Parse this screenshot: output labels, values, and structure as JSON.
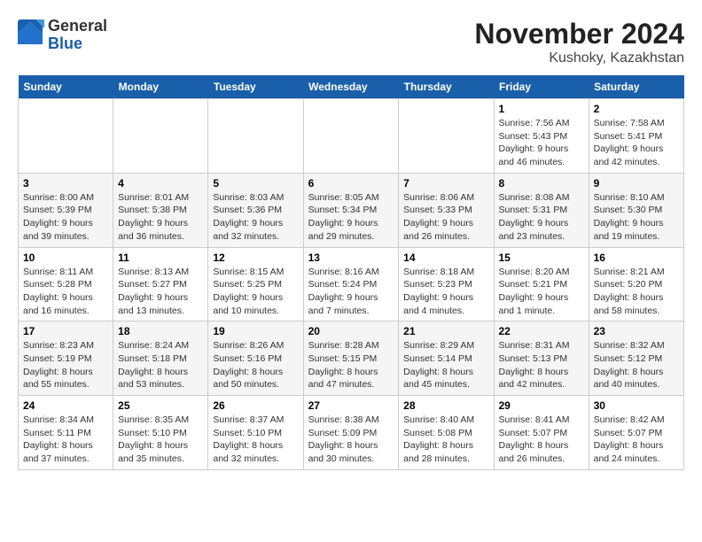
{
  "logo": {
    "general": "General",
    "blue": "Blue"
  },
  "title": "November 2024",
  "subtitle": "Kushoky, Kazakhstan",
  "days_of_week": [
    "Sunday",
    "Monday",
    "Tuesday",
    "Wednesday",
    "Thursday",
    "Friday",
    "Saturday"
  ],
  "weeks": [
    [
      {
        "day": "",
        "info": ""
      },
      {
        "day": "",
        "info": ""
      },
      {
        "day": "",
        "info": ""
      },
      {
        "day": "",
        "info": ""
      },
      {
        "day": "",
        "info": ""
      },
      {
        "day": "1",
        "info": "Sunrise: 7:56 AM\nSunset: 5:43 PM\nDaylight: 9 hours and 46 minutes."
      },
      {
        "day": "2",
        "info": "Sunrise: 7:58 AM\nSunset: 5:41 PM\nDaylight: 9 hours and 42 minutes."
      }
    ],
    [
      {
        "day": "3",
        "info": "Sunrise: 8:00 AM\nSunset: 5:39 PM\nDaylight: 9 hours and 39 minutes."
      },
      {
        "day": "4",
        "info": "Sunrise: 8:01 AM\nSunset: 5:38 PM\nDaylight: 9 hours and 36 minutes."
      },
      {
        "day": "5",
        "info": "Sunrise: 8:03 AM\nSunset: 5:36 PM\nDaylight: 9 hours and 32 minutes."
      },
      {
        "day": "6",
        "info": "Sunrise: 8:05 AM\nSunset: 5:34 PM\nDaylight: 9 hours and 29 minutes."
      },
      {
        "day": "7",
        "info": "Sunrise: 8:06 AM\nSunset: 5:33 PM\nDaylight: 9 hours and 26 minutes."
      },
      {
        "day": "8",
        "info": "Sunrise: 8:08 AM\nSunset: 5:31 PM\nDaylight: 9 hours and 23 minutes."
      },
      {
        "day": "9",
        "info": "Sunrise: 8:10 AM\nSunset: 5:30 PM\nDaylight: 9 hours and 19 minutes."
      }
    ],
    [
      {
        "day": "10",
        "info": "Sunrise: 8:11 AM\nSunset: 5:28 PM\nDaylight: 9 hours and 16 minutes."
      },
      {
        "day": "11",
        "info": "Sunrise: 8:13 AM\nSunset: 5:27 PM\nDaylight: 9 hours and 13 minutes."
      },
      {
        "day": "12",
        "info": "Sunrise: 8:15 AM\nSunset: 5:25 PM\nDaylight: 9 hours and 10 minutes."
      },
      {
        "day": "13",
        "info": "Sunrise: 8:16 AM\nSunset: 5:24 PM\nDaylight: 9 hours and 7 minutes."
      },
      {
        "day": "14",
        "info": "Sunrise: 8:18 AM\nSunset: 5:23 PM\nDaylight: 9 hours and 4 minutes."
      },
      {
        "day": "15",
        "info": "Sunrise: 8:20 AM\nSunset: 5:21 PM\nDaylight: 9 hours and 1 minute."
      },
      {
        "day": "16",
        "info": "Sunrise: 8:21 AM\nSunset: 5:20 PM\nDaylight: 8 hours and 58 minutes."
      }
    ],
    [
      {
        "day": "17",
        "info": "Sunrise: 8:23 AM\nSunset: 5:19 PM\nDaylight: 8 hours and 55 minutes."
      },
      {
        "day": "18",
        "info": "Sunrise: 8:24 AM\nSunset: 5:18 PM\nDaylight: 8 hours and 53 minutes."
      },
      {
        "day": "19",
        "info": "Sunrise: 8:26 AM\nSunset: 5:16 PM\nDaylight: 8 hours and 50 minutes."
      },
      {
        "day": "20",
        "info": "Sunrise: 8:28 AM\nSunset: 5:15 PM\nDaylight: 8 hours and 47 minutes."
      },
      {
        "day": "21",
        "info": "Sunrise: 8:29 AM\nSunset: 5:14 PM\nDaylight: 8 hours and 45 minutes."
      },
      {
        "day": "22",
        "info": "Sunrise: 8:31 AM\nSunset: 5:13 PM\nDaylight: 8 hours and 42 minutes."
      },
      {
        "day": "23",
        "info": "Sunrise: 8:32 AM\nSunset: 5:12 PM\nDaylight: 8 hours and 40 minutes."
      }
    ],
    [
      {
        "day": "24",
        "info": "Sunrise: 8:34 AM\nSunset: 5:11 PM\nDaylight: 8 hours and 37 minutes."
      },
      {
        "day": "25",
        "info": "Sunrise: 8:35 AM\nSunset: 5:10 PM\nDaylight: 8 hours and 35 minutes."
      },
      {
        "day": "26",
        "info": "Sunrise: 8:37 AM\nSunset: 5:10 PM\nDaylight: 8 hours and 32 minutes."
      },
      {
        "day": "27",
        "info": "Sunrise: 8:38 AM\nSunset: 5:09 PM\nDaylight: 8 hours and 30 minutes."
      },
      {
        "day": "28",
        "info": "Sunrise: 8:40 AM\nSunset: 5:08 PM\nDaylight: 8 hours and 28 minutes."
      },
      {
        "day": "29",
        "info": "Sunrise: 8:41 AM\nSunset: 5:07 PM\nDaylight: 8 hours and 26 minutes."
      },
      {
        "day": "30",
        "info": "Sunrise: 8:42 AM\nSunset: 5:07 PM\nDaylight: 8 hours and 24 minutes."
      }
    ]
  ]
}
